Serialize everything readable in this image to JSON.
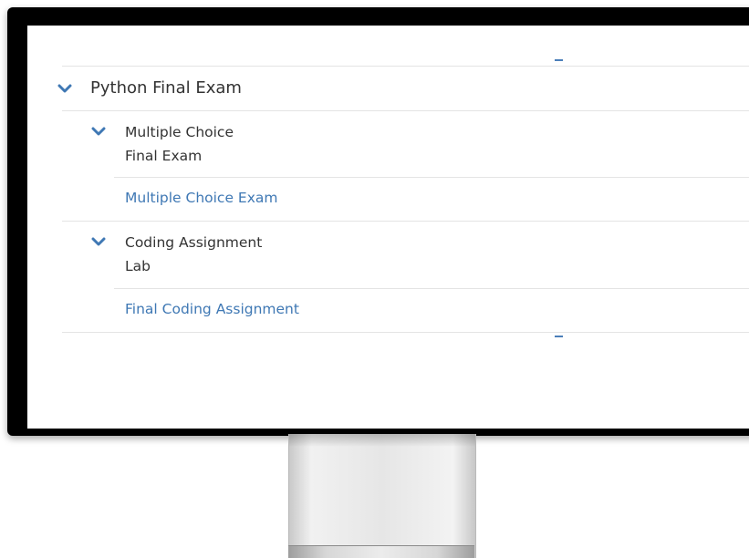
{
  "course": {
    "title": "Python Final Exam",
    "sections": [
      {
        "title": "Multiple Choice",
        "subtitle": "Final Exam",
        "link": "Multiple Choice Exam"
      },
      {
        "title": "Coding Assignment",
        "subtitle": "Lab",
        "link": "Final Coding Assignment"
      }
    ]
  },
  "icons": {
    "expand": "chevron-down-icon",
    "indicator": "dash-indicator"
  },
  "colors": {
    "accent": "#3f78b4",
    "text": "#333333",
    "divider": "#e4e4e4",
    "bezel": "#000000"
  }
}
